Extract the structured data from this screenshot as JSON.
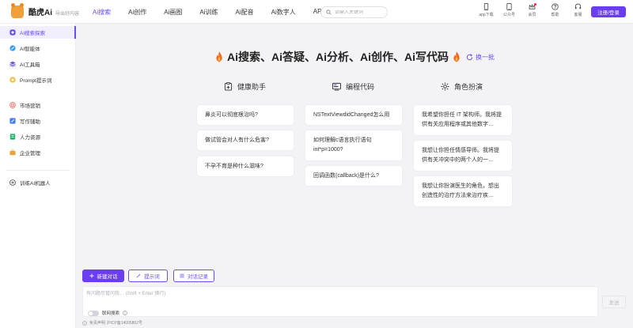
{
  "header": {
    "app_name": "酷虎Ai",
    "subtitle": "导出好内容",
    "nav": [
      "Ai搜索",
      "Ai创作",
      "Ai画图",
      "Ai训练",
      "Ai配音",
      "Ai数字人",
      "API"
    ],
    "search_placeholder": "请输入关键词",
    "icons": [
      {
        "label": "app下载",
        "icon": "phone-icon"
      },
      {
        "label": "公众号",
        "icon": "tablet-icon"
      },
      {
        "label": "会员",
        "icon": "crown-icon"
      },
      {
        "label": "帮助",
        "icon": "help-icon"
      },
      {
        "label": "客服",
        "icon": "headset-icon"
      }
    ],
    "login_label": "注册/登录"
  },
  "sidebar": {
    "items": [
      {
        "label": "AI搜索探索",
        "icon": "search-explore-icon",
        "color": "#6a4cf5"
      },
      {
        "label": "AI智能体",
        "icon": "agent-icon",
        "color": "#2f9bf3"
      },
      {
        "label": "AI工具箱",
        "icon": "toolbox-icon",
        "color": "#6a4cf5"
      },
      {
        "label": "Prompt提示词",
        "icon": "prompt-icon",
        "color": "#f5b623"
      },
      {
        "label": "市场营销",
        "icon": "target-icon",
        "color": "#f06a5a"
      },
      {
        "label": "写作辅助",
        "icon": "pen-icon",
        "color": "#4a7af5"
      },
      {
        "label": "人力资源",
        "icon": "hr-icon",
        "color": "#2dae6c"
      },
      {
        "label": "企业管理",
        "icon": "briefcase-icon",
        "color": "#e8a23a"
      },
      {
        "label": "训练AI机器人",
        "icon": "plus-circle-icon",
        "color": "#333333"
      }
    ]
  },
  "hero": {
    "title": "Ai搜索、Ai答疑、Ai分析、Ai创作、Ai写代码",
    "refresh_label": "换一批"
  },
  "columns": [
    {
      "title": "健康助手",
      "icon": "health-icon",
      "cards": [
        "鼻炎可以彻底根治吗?",
        "做试管会对人有什么危害?",
        "不孕不育是种什么滋味?"
      ]
    },
    {
      "title": "编程代码",
      "icon": "code-icon",
      "cards": [
        "NSTextViewdidChanged怎么用",
        "如何理解c语言执行语句int*p=1000?",
        "回调函数(callback)是什么?"
      ]
    },
    {
      "title": "角色扮演",
      "icon": "role-icon",
      "cards": [
        "我希望你担任 IT 架构师。我将提供有关应用程序或其他数字…",
        "我想让你担任情感导师。我将提供有关冲突中的两个人的一…",
        "我想让你扮演医生的角色，想出创造性的治疗方法来治疗疾…"
      ]
    }
  ],
  "composer": {
    "new_chat_label": "新建对话",
    "prompt_label": "提示词",
    "history_label": "对话记录",
    "input_placeholder": "有问题尽管问我… (Shift + Enter 换行)",
    "web_search_label": "联网搜索",
    "send_label": "发送"
  },
  "footer": {
    "text": "免责声明 沪ICP备14005862号"
  },
  "colors": {
    "accent": "#6a3df0",
    "flame": "#f26a1b"
  }
}
